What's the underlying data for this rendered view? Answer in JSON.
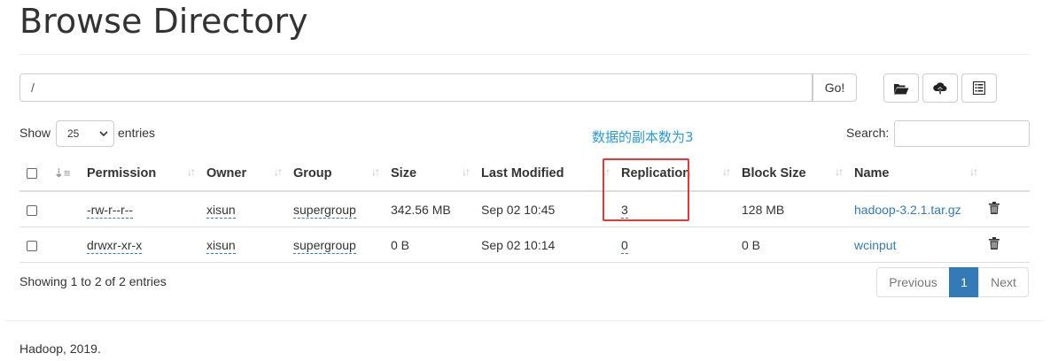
{
  "page": {
    "title": "Browse Directory"
  },
  "path_bar": {
    "value": "/",
    "go_label": "Go!"
  },
  "toolbar": {
    "icons": [
      "folder-open-icon",
      "cloud-upload-icon",
      "list-icon"
    ]
  },
  "length": {
    "show_label": "Show",
    "selected": "25",
    "entries_label": "entries"
  },
  "annotation": {
    "text": "数据的副本数为3",
    "color": "#2a9ad8"
  },
  "search": {
    "label": "Search:",
    "value": ""
  },
  "table": {
    "headers": [
      "Permission",
      "Owner",
      "Group",
      "Size",
      "Last Modified",
      "Replication",
      "Block Size",
      "Name"
    ],
    "rows": [
      {
        "permission": "-rw-r--r--",
        "owner": "xisun",
        "group": "supergroup",
        "size": "342.56 MB",
        "modified": "Sep 02 10:45",
        "replication": "3",
        "block_size": "128 MB",
        "name": "hadoop-3.2.1.tar.gz"
      },
      {
        "permission": "drwxr-xr-x",
        "owner": "xisun",
        "group": "supergroup",
        "size": "0 B",
        "modified": "Sep 02 10:14",
        "replication": "0",
        "block_size": "0 B",
        "name": "wcinput"
      }
    ]
  },
  "info": {
    "text": "Showing 1 to 2 of 2 entries"
  },
  "pagination": {
    "previous": "Previous",
    "current": "1",
    "next": "Next"
  },
  "footer": {
    "text": "Hadoop, 2019."
  },
  "colors": {
    "link": "#337ab7",
    "highlight": "#e53935",
    "active_page": "#337ab7"
  }
}
